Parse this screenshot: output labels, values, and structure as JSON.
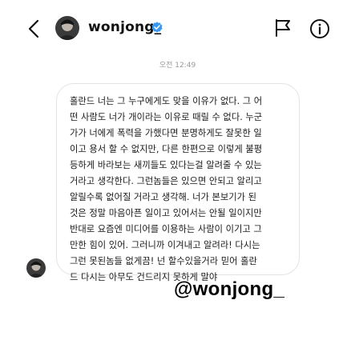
{
  "header": {
    "username": "wonjong_",
    "verified": true,
    "icons": {
      "back": "chevron-left-icon",
      "flag": "flag-icon",
      "info": "info-icon",
      "verified": "verified-badge-icon"
    }
  },
  "thread": {
    "timestamp": "오전 12:49",
    "message": "홀란드 너는 그 누구에게도 맞을 이유가 없다. 그 어\n떤 사람도 너가 개이라는 이유로 때릴 수 없다. 누군\n가가 너에게 폭력을 가했다면 분명하게도 잘못한 일\n이고 용서 할 수 없지만, 다른 한편으로 이렇게 불평\n등하게 바라보는 새끼들도 있다는걸 알려줄 수 있는\n거라고 생각한다. 그런놈들은 있으면 안되고 알리고\n알릴수록 없어질 거라고 생각해. 너가 본보기가 된\n것은 정말 마음아픈 일이고 있어서는 안될 일이지만\n반대로 요즘엔 미디어를 이용하는 사람이 이기고 그\n만한 힘이 있어. 그러니까 이겨내고 알려라! 다시는\n그런 못된놈들 없게끔! 넌 할수있을거라 믿어 홀란\n드 다시는 아무도 건드리지 못하게 말야"
  },
  "sticker": {
    "mention": "@wonjong_"
  },
  "colors": {
    "verified_blue": "#3897f0",
    "bubble_border": "#e3e3e3",
    "timestamp_gray": "#999999"
  }
}
